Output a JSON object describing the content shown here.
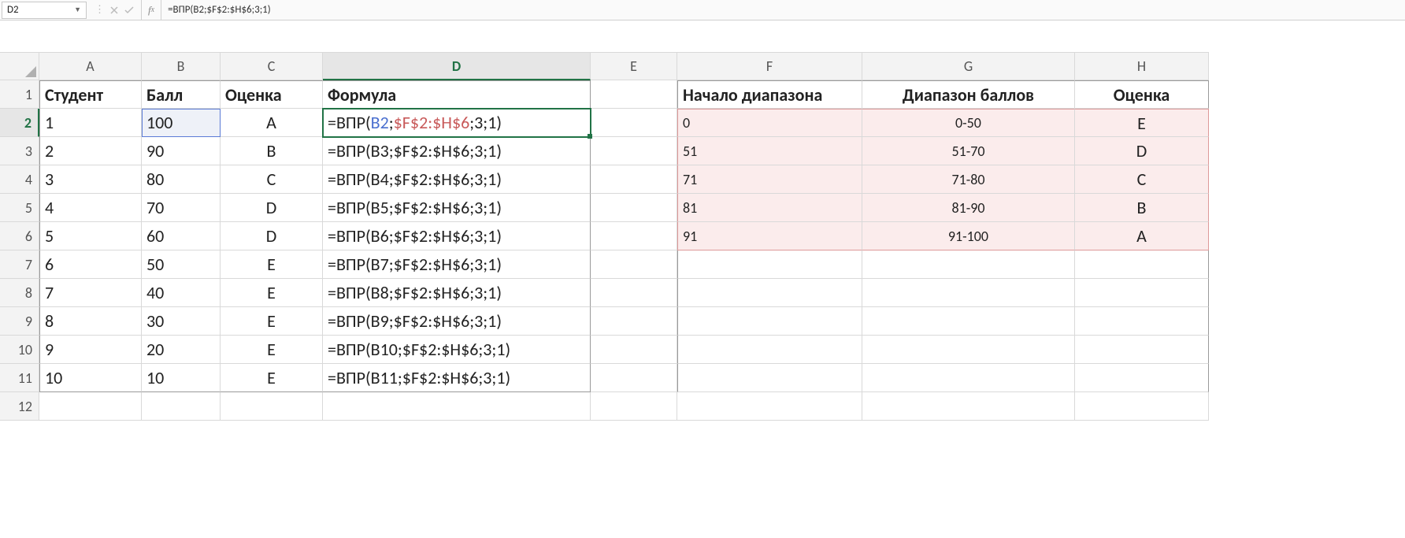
{
  "nameBox": "D2",
  "formulaBar": {
    "prefix": "=ВПР(",
    "ref1": "B2",
    "sep1": ";",
    "ref2": "$F$2:$H$6",
    "suffix": ";3;1)"
  },
  "columns": [
    "A",
    "B",
    "C",
    "D",
    "E",
    "F",
    "G",
    "H"
  ],
  "headers": {
    "A": "Студент",
    "B": "Балл",
    "C": "Оценка",
    "D": "Формула",
    "F": "Начало диапазона",
    "G": "Диапазон баллов",
    "H": "Оценка"
  },
  "students": [
    {
      "row": 2,
      "id": "1",
      "score": "100",
      "grade": "A",
      "formula": "=ВПР(B2;$F$2:$H$6;3;1)"
    },
    {
      "row": 3,
      "id": "2",
      "score": "90",
      "grade": "B",
      "formula": "=ВПР(B3;$F$2:$H$6;3;1)"
    },
    {
      "row": 4,
      "id": "3",
      "score": "80",
      "grade": "C",
      "formula": "=ВПР(B4;$F$2:$H$6;3;1)"
    },
    {
      "row": 5,
      "id": "4",
      "score": "70",
      "grade": "D",
      "formula": "=ВПР(B5;$F$2:$H$6;3;1)"
    },
    {
      "row": 6,
      "id": "5",
      "score": "60",
      "grade": "D",
      "formula": "=ВПР(B6;$F$2:$H$6;3;1)"
    },
    {
      "row": 7,
      "id": "6",
      "score": "50",
      "grade": "E",
      "formula": "=ВПР(B7;$F$2:$H$6;3;1)"
    },
    {
      "row": 8,
      "id": "7",
      "score": "40",
      "grade": "E",
      "formula": "=ВПР(B8;$F$2:$H$6;3;1)"
    },
    {
      "row": 9,
      "id": "8",
      "score": "30",
      "grade": "E",
      "formula": "=ВПР(B9;$F$2:$H$6;3;1)"
    },
    {
      "row": 10,
      "id": "9",
      "score": "20",
      "grade": "E",
      "formula": "=ВПР(B10;$F$2:$H$6;3;1)"
    },
    {
      "row": 11,
      "id": "10",
      "score": "10",
      "grade": "E",
      "formula": "=ВПР(B11;$F$2:$H$6;3;1)"
    }
  ],
  "lookup": [
    {
      "start": "0",
      "range": "0-50",
      "grade": "E"
    },
    {
      "start": "51",
      "range": "51-70",
      "grade": "D"
    },
    {
      "start": "71",
      "range": "71-80",
      "grade": "C"
    },
    {
      "start": "81",
      "range": "81-90",
      "grade": "B"
    },
    {
      "start": "91",
      "range": "91-100",
      "grade": "A"
    }
  ],
  "activeCell": "D2",
  "refCell": "B2"
}
